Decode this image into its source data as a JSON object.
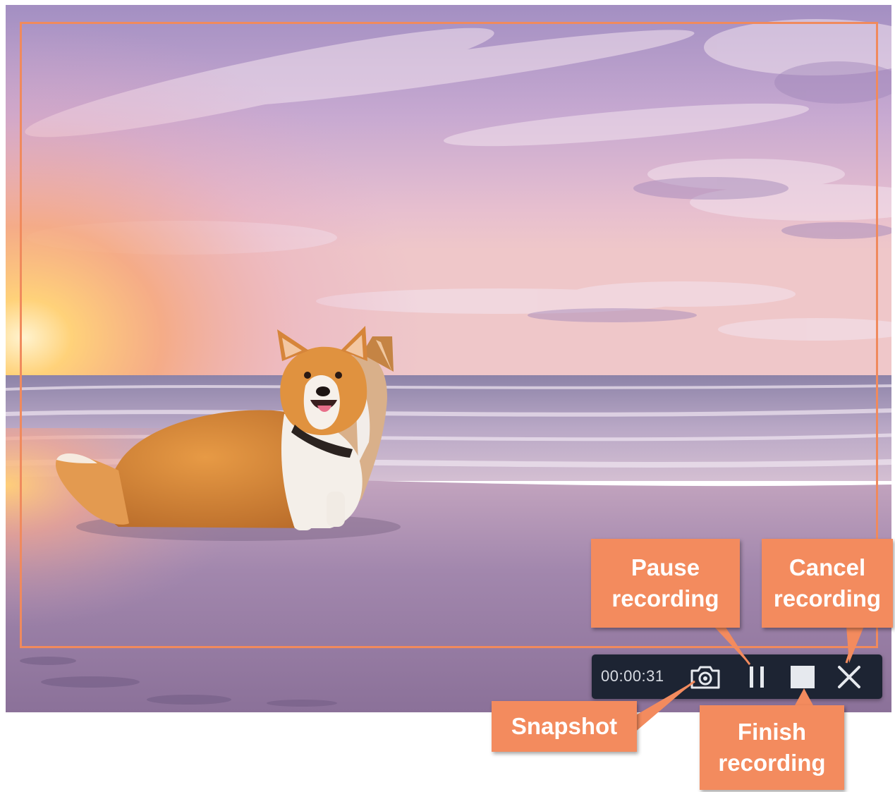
{
  "recorder": {
    "timer": "00:00:31",
    "buttons": {
      "snapshot": "camera-icon",
      "pause": "pause-icon",
      "stop": "stop-icon",
      "cancel": "close-icon"
    }
  },
  "callouts": {
    "pause": {
      "line1": "Pause",
      "line2": "recording"
    },
    "cancel": {
      "line1": "Cancel",
      "line2": "recording"
    },
    "snapshot": {
      "line1": "Snapshot"
    },
    "finish": {
      "line1": "Finish",
      "line2": "recording"
    }
  },
  "colors": {
    "accent": "#f38b5e",
    "frame": "#f08a5d",
    "panel": "#1d2433",
    "icon": "#e6e9ee"
  }
}
